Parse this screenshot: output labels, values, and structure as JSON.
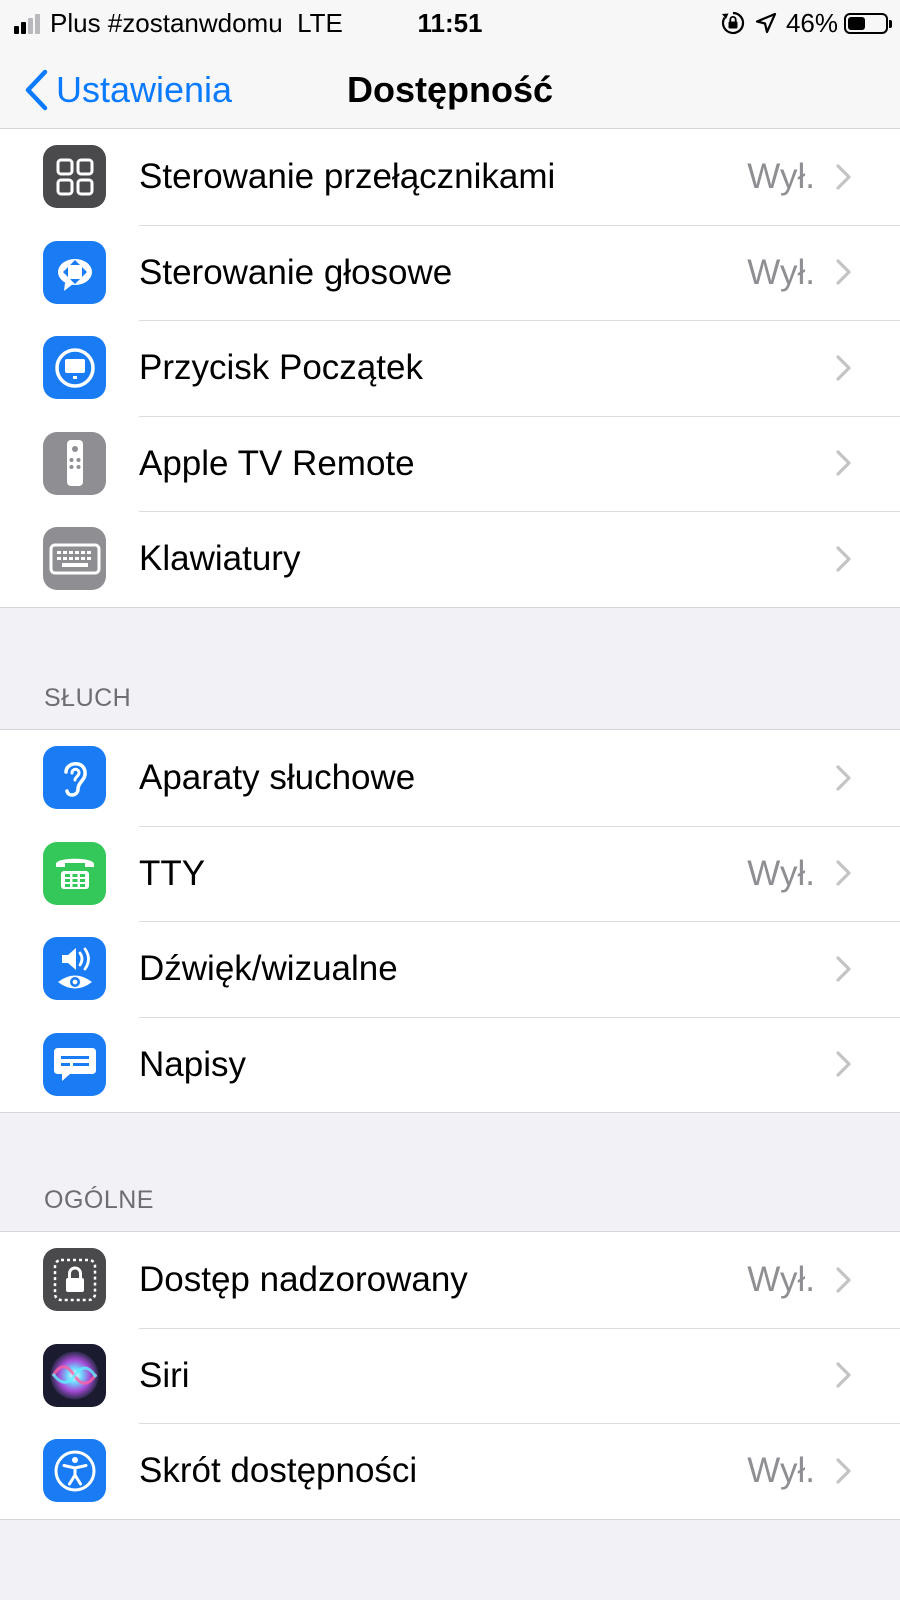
{
  "status_bar": {
    "carrier": "Plus #zostanwdomu  LTE",
    "time": "11:51",
    "battery_percent": "46%",
    "battery_level": 0.46
  },
  "nav": {
    "back_label": "Ustawienia",
    "title": "Dostępność"
  },
  "colors": {
    "accent": "#0a7aff",
    "icon_blue": "#1a7cf5",
    "icon_gray": "#8e8e93",
    "icon_dark": "#4a4a4c",
    "icon_green": "#34c759"
  },
  "groups": [
    {
      "header": "",
      "rows": [
        {
          "icon": "switch-control-icon",
          "label": "Sterowanie przełącznikami",
          "value": "Wył."
        },
        {
          "icon": "voice-control-icon",
          "label": "Sterowanie głosowe",
          "value": "Wył."
        },
        {
          "icon": "home-button-icon",
          "label": "Przycisk Początek",
          "value": ""
        },
        {
          "icon": "apple-tv-remote-icon",
          "label": "Apple TV Remote",
          "value": ""
        },
        {
          "icon": "keyboard-icon",
          "label": "Klawiatury",
          "value": ""
        }
      ]
    },
    {
      "header": "SŁUCH",
      "rows": [
        {
          "icon": "hearing-ear-icon",
          "label": "Aparaty słuchowe",
          "value": ""
        },
        {
          "icon": "tty-phone-icon",
          "label": "TTY",
          "value": "Wył."
        },
        {
          "icon": "audio-visual-icon",
          "label": "Dźwięk/wizualne",
          "value": ""
        },
        {
          "icon": "subtitles-icon",
          "label": "Napisy",
          "value": ""
        }
      ]
    },
    {
      "header": "OGÓLNE",
      "rows": [
        {
          "icon": "guided-access-lock-icon",
          "label": "Dostęp nadzorowany",
          "value": "Wył."
        },
        {
          "icon": "siri-icon",
          "label": "Siri",
          "value": ""
        },
        {
          "icon": "accessibility-shortcut-icon",
          "label": "Skrót dostępności",
          "value": "Wył."
        }
      ]
    }
  ]
}
